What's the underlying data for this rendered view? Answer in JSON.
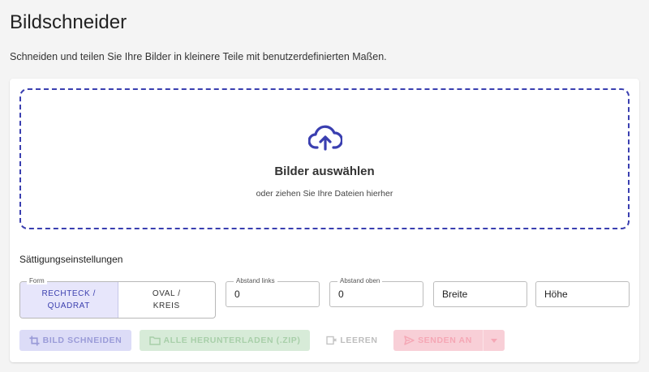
{
  "header": {
    "title": "Bildschneider",
    "subtitle": "Schneiden und teilen Sie Ihre Bilder in kleinere Teile mit benutzerdefinierten Maßen."
  },
  "dropzone": {
    "title": "Bilder auswählen",
    "subtitle": "oder ziehen Sie Ihre Dateien hierher",
    "icon": "cloud-upload-icon"
  },
  "settings": {
    "label": "Sättigungseinstellungen",
    "shape": {
      "legend": "Form",
      "options": [
        {
          "line1": "RECHTECK /",
          "line2": "QUADRAT",
          "selected": true
        },
        {
          "line1": "OVAL /",
          "line2": "KREIS",
          "selected": false
        }
      ]
    },
    "fields": {
      "left_margin": {
        "legend": "Abstand links",
        "value": "0"
      },
      "top_margin": {
        "legend": "Abstand oben",
        "value": "0"
      },
      "width": {
        "placeholder": "Breite"
      },
      "height": {
        "placeholder": "Höhe"
      }
    }
  },
  "actions": {
    "crop": "BILD SCHNEIDEN",
    "download": "ALLE HERUNTERLADEN (.ZIP)",
    "clear": "LEEREN",
    "send": "SENDEN AN"
  },
  "colors": {
    "accent": "#3a3fb0",
    "crop_disabled_bg": "#dcdcf7",
    "download_disabled_bg": "#d7ebd8",
    "send_disabled_bg": "#f8cfd7"
  }
}
